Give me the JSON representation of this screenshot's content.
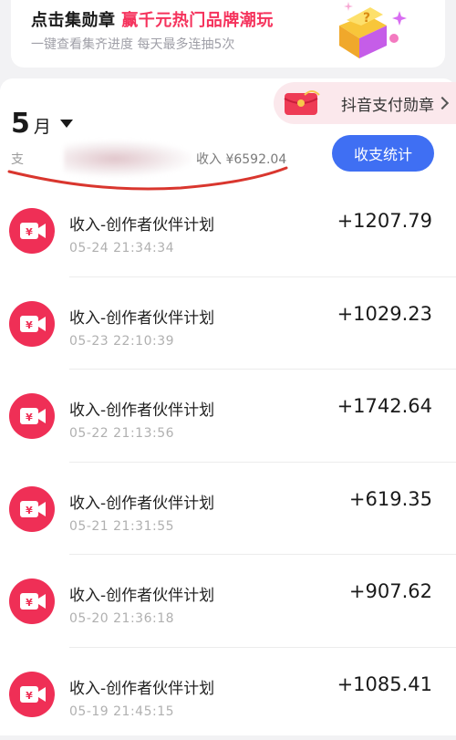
{
  "banner": {
    "title_prefix": "点击集勋章 ",
    "title_accent": "赢千元热门品牌潮玩",
    "subtitle": "一键查看集齐进度 每天最多连抽5次",
    "gift_icon": "gift-box-icon"
  },
  "header": {
    "month_number": "5",
    "month_unit": "月",
    "pay_badge_label": "抖音支付勋章",
    "summary_prefix": "支",
    "income_label": "收入 ¥6592.04",
    "stats_button": "收支统计"
  },
  "colors": {
    "accent_red": "#f5325c",
    "button_blue": "#3f6ff3",
    "icon_red": "#ef2f56"
  },
  "transactions": [
    {
      "title": "收入-创作者伙伴计划",
      "time": "05-24 21:34:34",
      "amount": "+1207.79"
    },
    {
      "title": "收入-创作者伙伴计划",
      "time": "05-23 22:10:39",
      "amount": "+1029.23"
    },
    {
      "title": "收入-创作者伙伴计划",
      "time": "05-22 21:13:56",
      "amount": "+1742.64"
    },
    {
      "title": "收入-创作者伙伴计划",
      "time": "05-21 21:31:55",
      "amount": "+619.35"
    },
    {
      "title": "收入-创作者伙伴计划",
      "time": "05-20 21:36:18",
      "amount": "+907.62"
    },
    {
      "title": "收入-创作者伙伴计划",
      "time": "05-19 21:45:15",
      "amount": "+1085.41"
    }
  ]
}
